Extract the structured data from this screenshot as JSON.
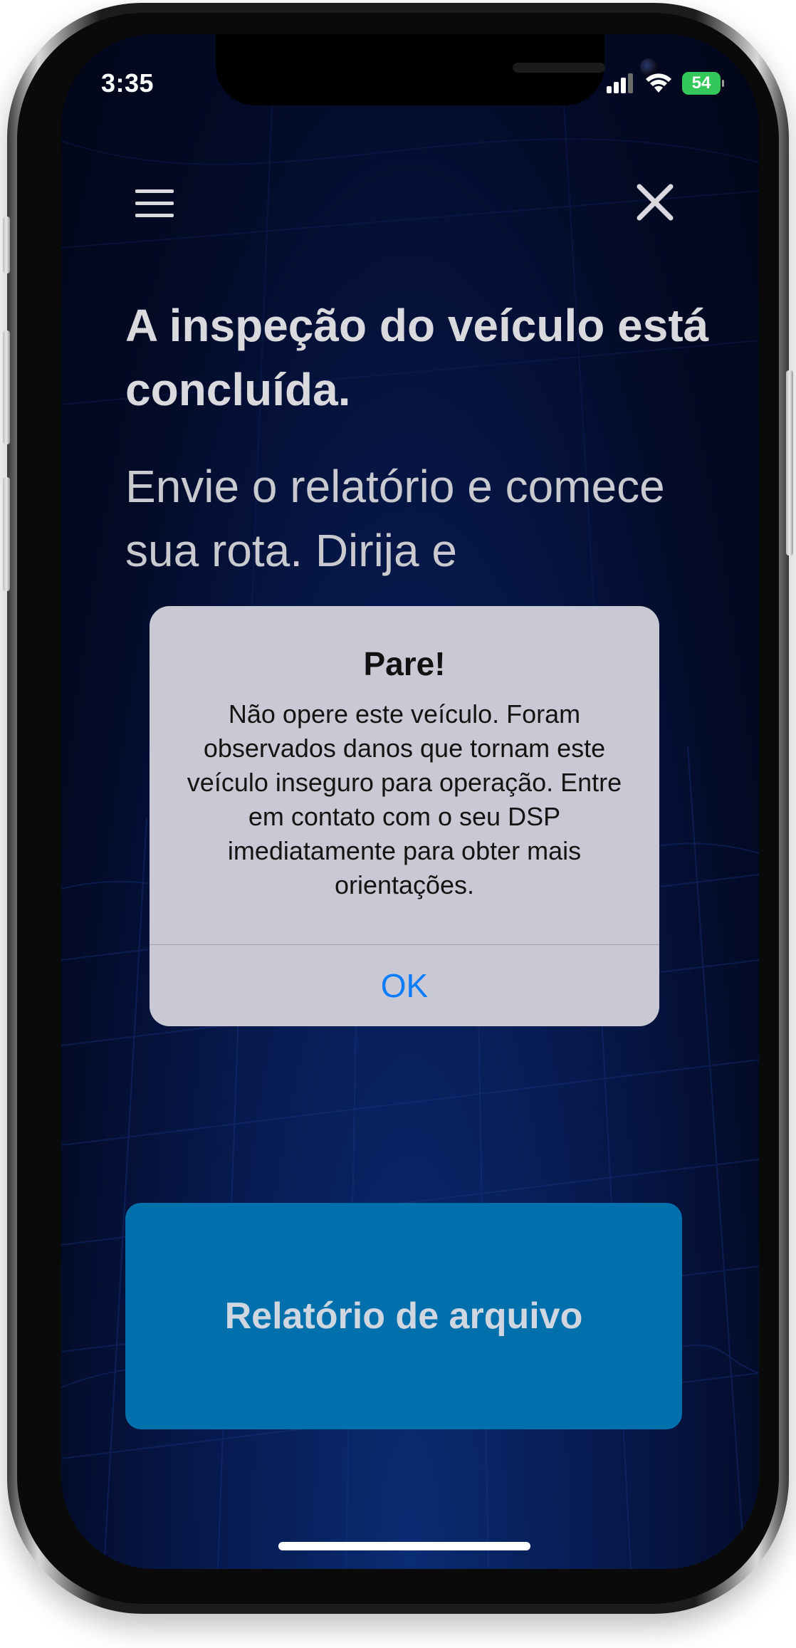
{
  "status_bar": {
    "time": "3:35",
    "battery": "54"
  },
  "header": {
    "menu_icon": "hamburger-menu-icon",
    "close_icon": "close-icon"
  },
  "main": {
    "title": "A inspeção do veículo está concluída.",
    "subtitle": "Envie o relatório e comece sua rota. Dirija e",
    "primary_button": "Relatório de arquivo"
  },
  "alert": {
    "title": "Pare!",
    "message": "Não opere este veículo. Foram observados danos que tornam este veículo inseguro para operação. Entre em contato com o seu DSP imediatamente para obter mais orientações.",
    "ok_label": "OK"
  },
  "colors": {
    "primary_button": "#0070ad",
    "alert_button_text": "#0a7cff",
    "battery": "#34c759",
    "background": "#030a26"
  }
}
